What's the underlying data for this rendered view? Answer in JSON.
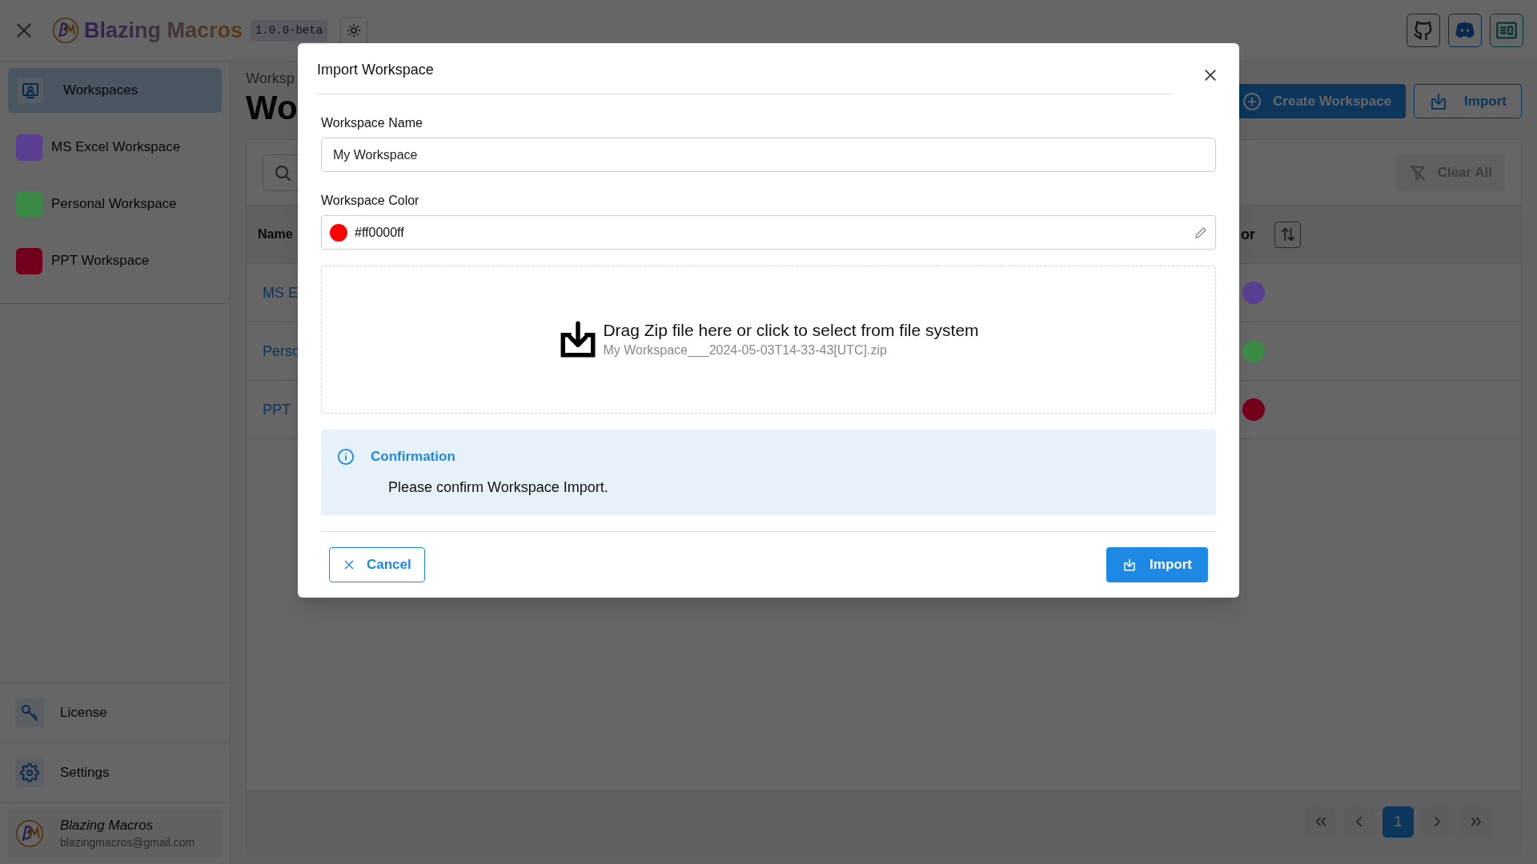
{
  "header": {
    "title": "Blazing Macros",
    "version": "1.0.0-beta"
  },
  "sidebar": {
    "items": [
      {
        "kind": "nav",
        "label": "Workspaces",
        "selected": true
      },
      {
        "kind": "workspace",
        "label": "MS Excel Workspace",
        "color": "#5a3e92",
        "selected": false
      },
      {
        "kind": "workspace",
        "label": "Personal Workspace",
        "color": "#3b8a45",
        "selected": false
      },
      {
        "kind": "workspace",
        "label": "PPT Workspace",
        "color": "#72001a",
        "selected": false
      }
    ],
    "bottom": [
      {
        "kind": "license",
        "label": "License"
      },
      {
        "kind": "settings",
        "label": "Settings"
      }
    ],
    "user": {
      "name": "Blazing Macros",
      "email": "blazingmacros@gmail.com"
    }
  },
  "main": {
    "breadcrumb": "Worksp",
    "heading": "Wo",
    "create_button": "Create Workspace",
    "import_button": "Import",
    "clear_button": "Clear All",
    "columns": [
      "Name",
      "or"
    ],
    "rows": [
      {
        "name": "MS E",
        "color": "#5a3e92"
      },
      {
        "name": "Perso",
        "color": "#3b8a45"
      },
      {
        "name": "PPT",
        "color": "#72001a"
      }
    ],
    "pages": [
      {
        "label": "1",
        "selected": true
      }
    ]
  },
  "dialog": {
    "title": "Import Workspace",
    "name_label": "Workspace Name",
    "name_value": "My Workspace",
    "color_label": "Workspace Color",
    "color_value": "#ff0000ff",
    "color": "#ff0000",
    "drop_title": "Drag Zip file here or click to select from file system",
    "drop_file": "My Workspace___2024-05-03T14-33-43[UTC].zip",
    "alert_title": "Confirmation",
    "alert_message": "Please confirm Workspace Import.",
    "cancel": "Cancel",
    "confirm": "Import"
  }
}
